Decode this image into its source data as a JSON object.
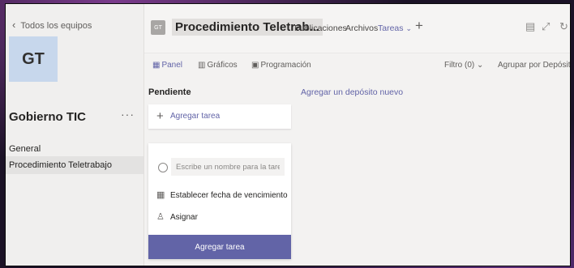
{
  "sidebar": {
    "back_label": "Todos los equipos",
    "team_avatar": "GT",
    "team_name": "Gobierno TIC",
    "more_label": "···",
    "channels": [
      "General",
      "Procedimiento Teletrabajo"
    ]
  },
  "header": {
    "channel_avatar": "GT",
    "title": "Procedimiento Teletrab...",
    "tabs": [
      "Publicaciones",
      "Archivos",
      "Tareas"
    ],
    "active_tab": "Tareas",
    "add_tab": "+"
  },
  "toolbar": {
    "views": [
      "Panel",
      "Gráficos",
      "Programación"
    ],
    "active_view": "Panel",
    "filter_label": "Filtro (0)",
    "group_label": "Agrupar por Depósito"
  },
  "board": {
    "bucket_title": "Pendiente",
    "add_bucket_label": "Agregar un depósito nuevo",
    "add_task_label": "Agregar tarea",
    "form": {
      "name_placeholder": "Escribe un nombre para la tarea.",
      "due_date_label": "Establecer fecha de vencimiento",
      "assign_label": "Asignar",
      "submit_label": "Agregar tarea"
    }
  },
  "icons": [
    "chevron-left-icon",
    "ellipsis-icon",
    "chevron-down-icon",
    "plus-icon",
    "conversation-icon",
    "expand-icon",
    "refresh-icon",
    "globe-icon",
    "board-icon",
    "chart-icon",
    "schedule-icon",
    "calendar-icon",
    "assign-icon"
  ],
  "colors": {
    "accent": "#6264a7",
    "sidebar_bg": "#f0efee",
    "canvas_bg": "#f3f2f1"
  }
}
